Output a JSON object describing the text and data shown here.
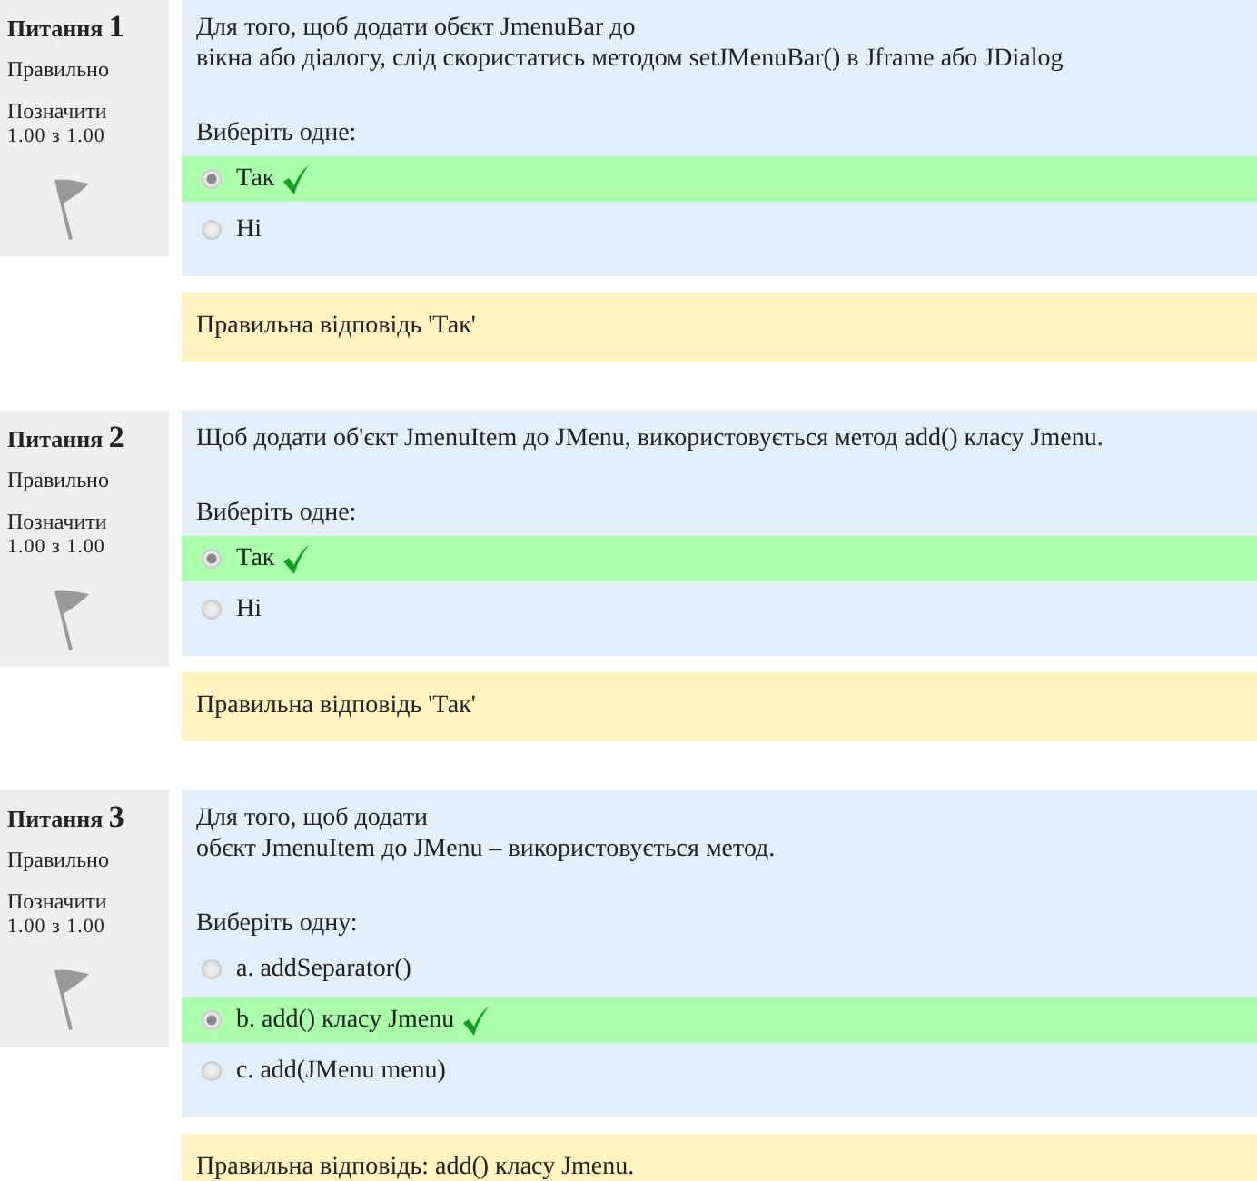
{
  "questions": [
    {
      "label": "Питання",
      "number": "1",
      "state": "Правильно",
      "flag_label": "Позначити",
      "mark": "1.00 з 1.00",
      "text_lines": [
        "Для того, щоб додати обєкт JmenuBar до",
        "вікна або діалогу, слід скористатись методом setJMenuBar() в Jframe або JDialog"
      ],
      "prompt": "Виберіть одне:",
      "options": [
        {
          "label": "Так",
          "selected": true,
          "correct": true
        },
        {
          "label": "Ні",
          "selected": false,
          "correct": false
        }
      ],
      "feedback": "Правильна відповідь 'Так'"
    },
    {
      "label": "Питання",
      "number": "2",
      "state": "Правильно",
      "flag_label": "Позначити",
      "mark": "1.00 з 1.00",
      "text_lines": [
        "Щоб додати об'єкт JmenuItem до JMenu, використовується метод add() класу Jmenu."
      ],
      "prompt": "Виберіть одне:",
      "options": [
        {
          "label": "Так",
          "selected": true,
          "correct": true
        },
        {
          "label": "Ні",
          "selected": false,
          "correct": false
        }
      ],
      "feedback": "Правильна відповідь 'Так'"
    },
    {
      "label": "Питання",
      "number": "3",
      "state": "Правильно",
      "flag_label": "Позначити",
      "mark": "1.00 з 1.00",
      "text_lines": [
        "Для того, щоб додати",
        "обєкт JmenuItem до JMenu – використовується метод."
      ],
      "prompt": "Виберіть одну:",
      "options": [
        {
          "label": "a. addSeparator()",
          "selected": false,
          "correct": false
        },
        {
          "label": "b. add() класу Jmenu",
          "selected": true,
          "correct": true
        },
        {
          "label": "c. add(JMenu menu)",
          "selected": false,
          "correct": false
        }
      ],
      "feedback": "Правильна відповідь: add() класу Jmenu."
    }
  ]
}
